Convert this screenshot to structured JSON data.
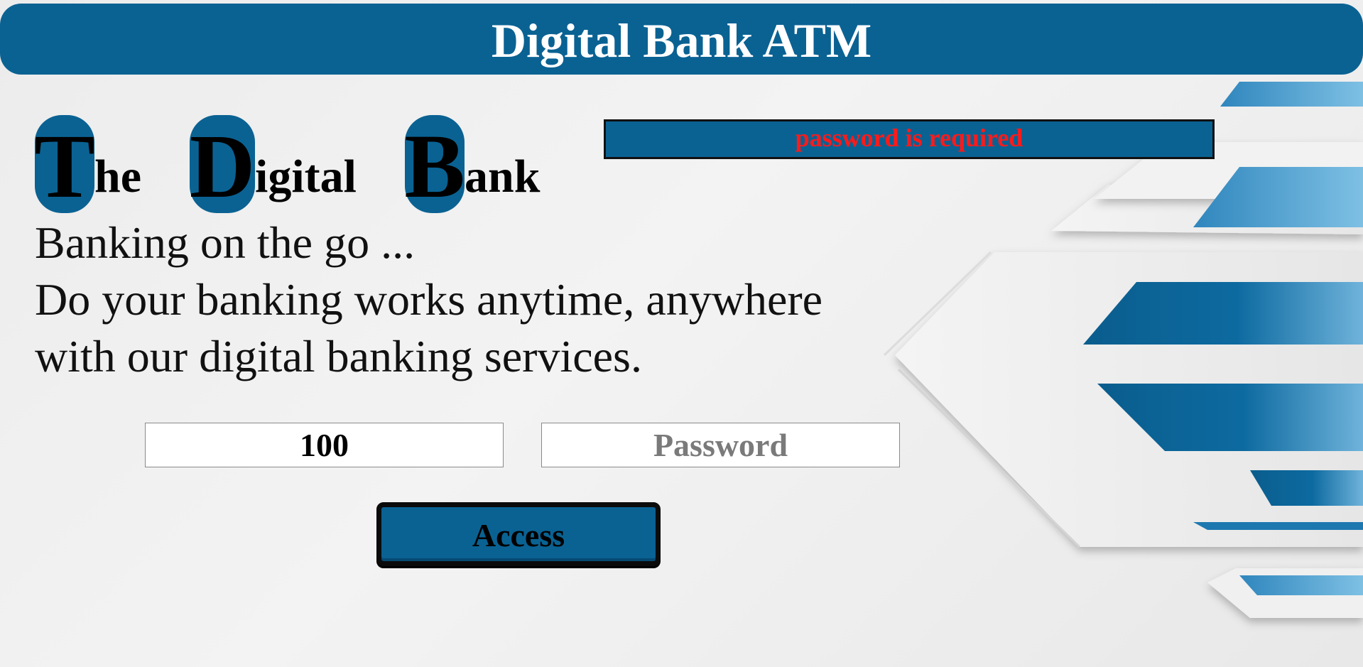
{
  "header": {
    "title": "Digital Bank ATM"
  },
  "brand": {
    "words": [
      {
        "cap": "T",
        "rest": "he"
      },
      {
        "cap": "D",
        "rest": "igital"
      },
      {
        "cap": "B",
        "rest": "ank"
      }
    ]
  },
  "tagline": {
    "line1": "Banking on the go ...",
    "line2": "Do your banking works anytime, anywhere",
    "line3": "with our digital banking services."
  },
  "error": {
    "message": "password is required"
  },
  "form": {
    "account_value": "100",
    "password_value": "",
    "password_placeholder": "Password",
    "access_label": "Access"
  },
  "colors": {
    "brand_blue": "#0a6293",
    "error_red": "#ff1a1a",
    "background": "#ececec"
  }
}
